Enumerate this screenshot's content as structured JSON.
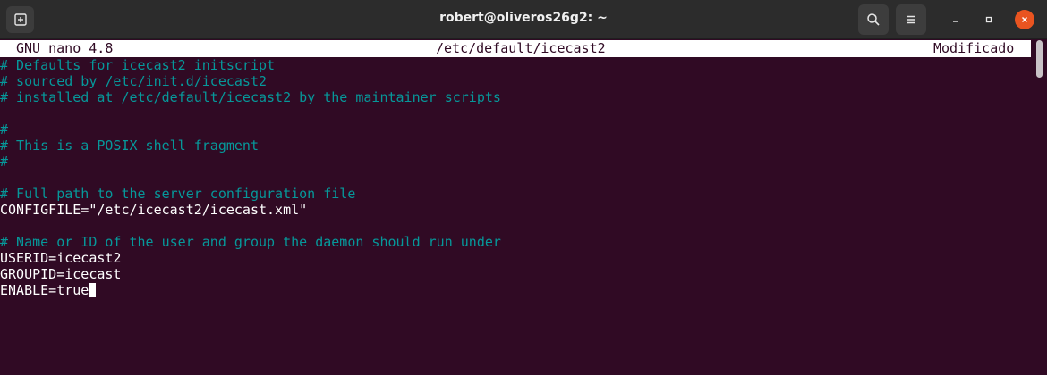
{
  "window": {
    "title": "robert@oliveros26g2: ~"
  },
  "icons": {
    "new_tab": "new-tab-icon",
    "search": "search-icon",
    "menu": "hamburger-menu-icon",
    "minimize": "minimize-icon",
    "maximize": "maximize-icon",
    "close": "close-icon"
  },
  "colors": {
    "terminal_bg": "#300a24",
    "comment": "#06989a",
    "close_button": "#e95420"
  },
  "nano": {
    "version": "GNU nano 4.8",
    "filename": "/etc/default/icecast2",
    "status": "Modificado"
  },
  "lines": [
    "# Defaults for icecast2 initscript",
    "# sourced by /etc/init.d/icecast2",
    "# installed at /etc/default/icecast2 by the maintainer scripts",
    "",
    "#",
    "# This is a POSIX shell fragment",
    "#",
    "",
    "# Full path to the server configuration file",
    "CONFIGFILE=\"/etc/icecast2/icecast.xml\"",
    "",
    "# Name or ID of the user and group the daemon should run under",
    "USERID=icecast2",
    "GROUPID=icecast",
    "ENABLE=true"
  ]
}
